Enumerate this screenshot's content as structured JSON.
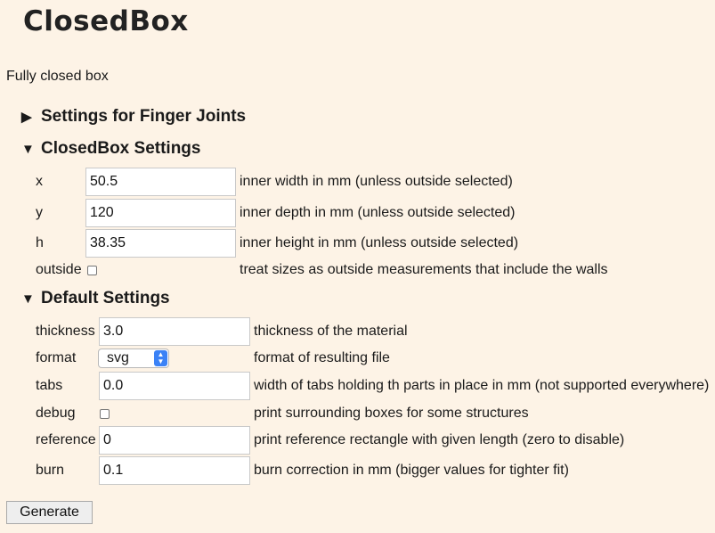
{
  "logo": "ClosedBox",
  "subtitle": "Fully closed box",
  "sections": {
    "finger": {
      "arrow": "▶",
      "title": "Settings for Finger Joints"
    },
    "closedbox": {
      "arrow": "▼",
      "title": "ClosedBox Settings"
    },
    "default": {
      "arrow": "▼",
      "title": "Default Settings"
    }
  },
  "closedbox": {
    "x": {
      "label": "x",
      "value": "50.5",
      "desc": "inner width in mm (unless outside selected)"
    },
    "y": {
      "label": "y",
      "value": "120",
      "desc": "inner depth in mm (unless outside selected)"
    },
    "h": {
      "label": "h",
      "value": "38.35",
      "desc": "inner height in mm (unless outside selected)"
    },
    "outside": {
      "label": "outside",
      "checked": false,
      "desc": "treat sizes as outside measurements that include the walls"
    }
  },
  "defaults": {
    "thickness": {
      "label": "thickness",
      "value": "3.0",
      "desc": "thickness of the material"
    },
    "format": {
      "label": "format",
      "value": "svg",
      "desc": "format of resulting file"
    },
    "tabs": {
      "label": "tabs",
      "value": "0.0",
      "desc": "width of tabs holding th parts in place in mm (not supported everywhere)"
    },
    "debug": {
      "label": "debug",
      "checked": false,
      "desc": "print surrounding boxes for some structures"
    },
    "reference": {
      "label": "reference",
      "value": "0",
      "desc": "print reference rectangle with given length (zero to disable)"
    },
    "burn": {
      "label": "burn",
      "value": "0.1",
      "desc": "burn correction in mm (bigger values for tighter fit)"
    }
  },
  "generate_label": "Generate"
}
